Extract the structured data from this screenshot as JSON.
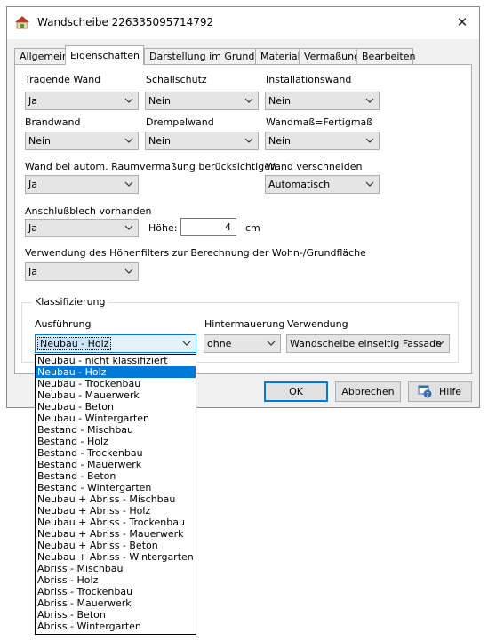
{
  "window": {
    "title": "Wandscheibe 226335095714792",
    "close_icon": "close-icon"
  },
  "tabs": [
    {
      "label": "Allgemein"
    },
    {
      "label": "Eigenschaften"
    },
    {
      "label": "Darstellung im Grundriss"
    },
    {
      "label": "Material"
    },
    {
      "label": "Vermaßung"
    },
    {
      "label": "Bearbeiten"
    }
  ],
  "active_tab": "Eigenschaften",
  "fields": {
    "tragende_wand": {
      "label": "Tragende Wand",
      "value": "Ja"
    },
    "schallschutz": {
      "label": "Schallschutz",
      "value": "Nein"
    },
    "installationswand": {
      "label": "Installationswand",
      "value": "Nein"
    },
    "brandwand": {
      "label": "Brandwand",
      "value": "Nein"
    },
    "drempelwand": {
      "label": "Drempelwand",
      "value": "Nein"
    },
    "wandmass": {
      "label": "Wandmaß=Fertigmaß",
      "value": "Nein"
    },
    "raumvermassung": {
      "label": "Wand bei autom. Raumvermaßung berücksichtigen",
      "value": "Ja"
    },
    "verschneiden": {
      "label": "Wand verschneiden",
      "value": "Automatisch"
    },
    "anschlussblech": {
      "label": "Anschlußblech vorhanden",
      "value": "Ja"
    },
    "hoehe": {
      "label": "Höhe:",
      "value": "4",
      "unit": "cm"
    },
    "hoehenfilter": {
      "label": "Verwendung des Höhenfilters zur Berechnung der Wohn-/Grundfläche",
      "value": "Ja"
    }
  },
  "klassifizierung": {
    "title": "Klassifizierung",
    "ausfuehrung": {
      "label": "Ausführung",
      "value": "Neubau - Holz"
    },
    "hintermauerung": {
      "label": "Hintermauerung",
      "value": "ohne"
    },
    "verwendung": {
      "label": "Verwendung",
      "value": "Wandscheibe einseitig Fassade"
    }
  },
  "buttons": {
    "ok": "OK",
    "abbrechen": "Abbrechen",
    "hilfe": "Hilfe"
  },
  "dropdown": {
    "selected_index": 1,
    "options": [
      "Neubau - nicht klassifiziert",
      "Neubau - Holz",
      "Neubau - Trockenbau",
      "Neubau - Mauerwerk",
      "Neubau - Beton",
      "Neubau - Wintergarten",
      "Bestand - Mischbau",
      "Bestand - Holz",
      "Bestand - Trockenbau",
      "Bestand - Mauerwerk",
      "Bestand - Beton",
      "Bestand - Wintergarten",
      "Neubau + Abriss - Mischbau",
      "Neubau + Abriss - Holz",
      "Neubau + Abriss - Trockenbau",
      "Neubau + Abriss - Mauerwerk",
      "Neubau + Abriss - Beton",
      "Neubau + Abriss - Wintergarten",
      "Abriss - Mischbau",
      "Abriss - Holz",
      "Abriss - Trockenbau",
      "Abriss - Mauerwerk",
      "Abriss - Beton",
      "Abriss - Wintergarten"
    ]
  },
  "colors": {
    "accent": "#0078d7",
    "dialog_bg": "#f0f0f0",
    "combo_bg": "#e5e5e5"
  }
}
